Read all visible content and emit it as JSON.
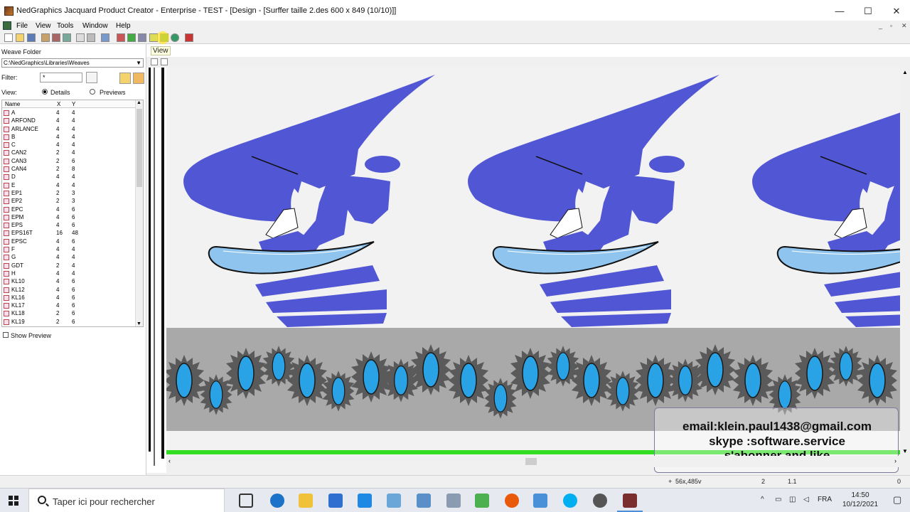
{
  "window": {
    "title": "NedGraphics Jacquard Product Creator - Enterprise - TEST - [Design - [Surffer taille 2.des 600 x 849 (10/10)]]",
    "min": "—",
    "max": "☐",
    "close": "✕"
  },
  "menu": {
    "items": [
      "File",
      "View",
      "Tools",
      "Window",
      "Help"
    ],
    "mdi_min": "_",
    "mdi_restore": "▫",
    "mdi_close": "✕"
  },
  "toolbar": {
    "tooltip": "View"
  },
  "weave_panel": {
    "title": "Weave Folder",
    "path": "C:\\NedGraphics\\Libraries\\Weaves",
    "filter_label": "Filter:",
    "filter_value": "*",
    "view_label": "View:",
    "view_options": [
      "Details",
      "Previews"
    ],
    "view_selected": "Details",
    "columns": [
      "Name",
      "X",
      "Y"
    ],
    "rows": [
      {
        "name": "A",
        "x": "4",
        "y": "4"
      },
      {
        "name": "ARFOND",
        "x": "4",
        "y": "4"
      },
      {
        "name": "ARLANCE",
        "x": "4",
        "y": "4"
      },
      {
        "name": "B",
        "x": "4",
        "y": "4"
      },
      {
        "name": "C",
        "x": "4",
        "y": "4"
      },
      {
        "name": "CAN2",
        "x": "2",
        "y": "4"
      },
      {
        "name": "CAN3",
        "x": "2",
        "y": "6"
      },
      {
        "name": "CAN4",
        "x": "2",
        "y": "8"
      },
      {
        "name": "D",
        "x": "4",
        "y": "4"
      },
      {
        "name": "E",
        "x": "4",
        "y": "4"
      },
      {
        "name": "EP1",
        "x": "2",
        "y": "3"
      },
      {
        "name": "EP2",
        "x": "2",
        "y": "3"
      },
      {
        "name": "EPC",
        "x": "4",
        "y": "6"
      },
      {
        "name": "EPM",
        "x": "4",
        "y": "6"
      },
      {
        "name": "EPS",
        "x": "4",
        "y": "6"
      },
      {
        "name": "EPS16T",
        "x": "16",
        "y": "48"
      },
      {
        "name": "EPSC",
        "x": "4",
        "y": "6"
      },
      {
        "name": "F",
        "x": "4",
        "y": "4"
      },
      {
        "name": "G",
        "x": "4",
        "y": "4"
      },
      {
        "name": "GDT",
        "x": "2",
        "y": "4"
      },
      {
        "name": "H",
        "x": "4",
        "y": "4"
      },
      {
        "name": "KL10",
        "x": "4",
        "y": "6"
      },
      {
        "name": "KL12",
        "x": "4",
        "y": "6"
      },
      {
        "name": "KL16",
        "x": "4",
        "y": "6"
      },
      {
        "name": "KL17",
        "x": "4",
        "y": "6"
      },
      {
        "name": "KL18",
        "x": "2",
        "y": "6"
      },
      {
        "name": "KL19",
        "x": "2",
        "y": "6"
      }
    ],
    "show_preview_label": "Show Preview"
  },
  "overlay": {
    "line1": "email:klein.paul1438@gmail.com",
    "line2": "skype :software.service",
    "line3": "s'abonner  and   like"
  },
  "statusbar": {
    "coords": "56x,485v",
    "val1": "2",
    "val2": "1.1",
    "val3": "0"
  },
  "taskbar": {
    "search_placeholder": "Taper ici pour rechercher",
    "lang": "FRA",
    "time": "14:50",
    "date": "10/12/2021"
  },
  "colors": {
    "sail": "#5156d4",
    "board_fill": "#8fc4ee",
    "band_gray": "#a9a9a9",
    "oval_blue": "#2aa3e6",
    "green_bar": "#33dd22"
  }
}
